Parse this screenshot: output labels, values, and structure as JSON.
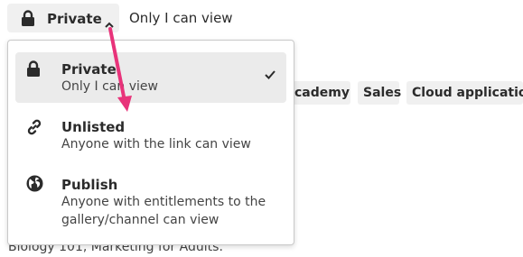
{
  "privacy_button": {
    "label": "Private",
    "description": "Only I can view",
    "icon": "lock-icon",
    "chevron": "chevron-up-icon"
  },
  "tags": [
    "cademy",
    "Sales",
    "Cloud applications"
  ],
  "footer_text": "Biology 101, Marketing for Adults.",
  "dropdown": {
    "options": [
      {
        "title": "Private",
        "description": "Only I can view",
        "icon": "lock-icon",
        "selected": true
      },
      {
        "title": "Unlisted",
        "description": "Anyone with the link can view",
        "icon": "link-icon",
        "selected": false
      },
      {
        "title": "Publish",
        "description": "Anyone with entitlements to the gallery/channel can view",
        "icon": "globe-icon",
        "selected": false
      }
    ]
  },
  "colors": {
    "annotation_arrow": "#e8337a",
    "chip_background": "#f0f0f0",
    "selected_option_background": "#ebebeb"
  }
}
